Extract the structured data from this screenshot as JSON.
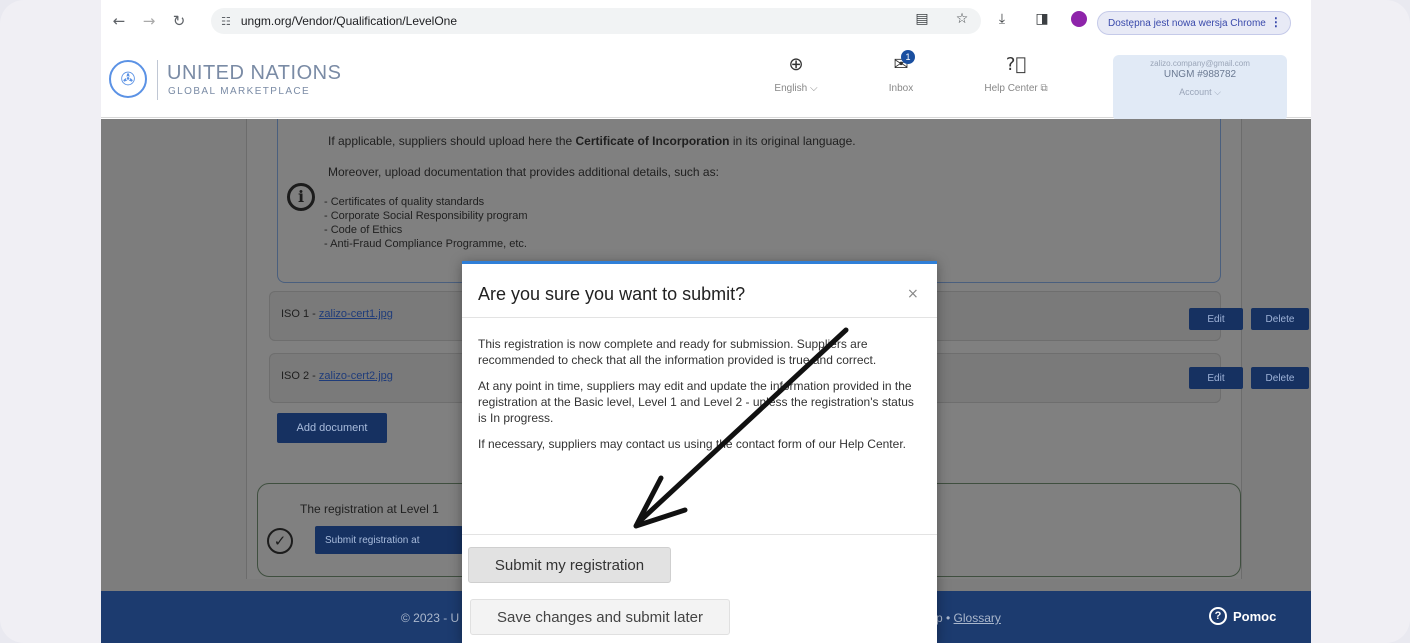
{
  "browser": {
    "url": "ungm.org/Vendor/Qualification/LevelOne",
    "update_notice": "Dostępna jest nowa wersja Chrome"
  },
  "header": {
    "brand_name": "UNITED NATIONS",
    "brand_sub": "GLOBAL MARKETPLACE",
    "language_label": "English ⌵",
    "inbox_label": "Inbox",
    "inbox_count": "1",
    "help_label": "Help Center ⧉",
    "account_email": "zalizo.company@gmail.com",
    "account_id": "UNGM #988782",
    "account_label": "Account ⌵"
  },
  "info": {
    "line1_prefix": "If applicable, suppliers should upload here the ",
    "line1_bold": "Certificate of Incorporation",
    "line1_suffix": " in its original language.",
    "line2": "Moreover, upload documentation that provides additional details, such as:",
    "items": [
      "- Certificates of quality standards",
      "- Corporate Social Responsibility program",
      "- Code of Ethics",
      "- Anti-Fraud Compliance Programme, etc."
    ]
  },
  "documents": [
    {
      "prefix": "ISO 1 - ",
      "file": "zalizo-cert1.jpg",
      "edit": "Edit",
      "delete": "Delete"
    },
    {
      "prefix": "ISO 2 - ",
      "file": "zalizo-cert2.jpg",
      "edit": "Edit",
      "delete": "Delete"
    }
  ],
  "add_document": "Add document",
  "level": {
    "text": "The registration at Level 1",
    "button": "Submit registration at"
  },
  "footer": {
    "left": "© 2023 - U",
    "right_prefix": "p • ",
    "glossary": "Glossary",
    "help": "Pomoc"
  },
  "modal": {
    "title": "Are you sure you want to submit?",
    "close": "×",
    "para1": "This registration is now complete and ready for submission. Suppliers are recommended to check that all the information provided is true and correct.",
    "para2": "At any point in time, suppliers may edit and update the information provided in the registration at the Basic level, Level 1 and Level 2 - unless the registration's status is In progress.",
    "para3": "If necessary, suppliers may contact us using the contact form of our Help Center.",
    "submit_button": "Submit my registration",
    "later_button": "Save changes and submit later"
  }
}
